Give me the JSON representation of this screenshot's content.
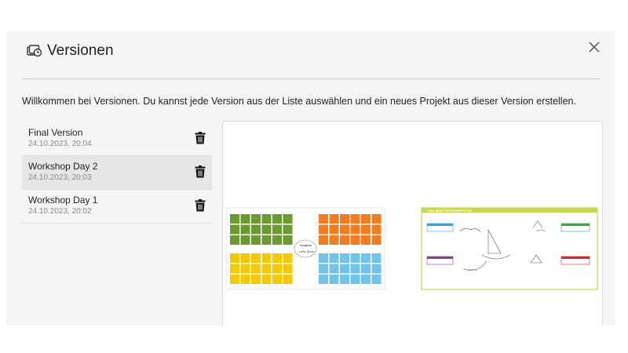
{
  "dialog": {
    "title": "Versionen",
    "title_icon": "versions-icon",
    "close_icon": "close-icon",
    "welcome_text": "Willkommen bei Versionen. Du kannst jede Version aus der Liste auswählen und ein neues Projekt aus dieser Version erstellen."
  },
  "versions": [
    {
      "name": "Final Version",
      "date": "24.10.2023, 20:04",
      "selected": false
    },
    {
      "name": "Workshop Day 2",
      "date": "24.10.2023, 20:03",
      "selected": true
    },
    {
      "name": "Workshop Day 1",
      "date": "24.10.2023, 20:02",
      "selected": false
    }
  ],
  "preview": {
    "board_left": {
      "center_labels": [
        "Keep",
        "Add",
        "Less",
        "More"
      ],
      "colors": {
        "green": "#6b9a33",
        "orange": "#f47b20",
        "yellow": "#f5c800",
        "blue": "#6fc3ec"
      }
    },
    "board_right": {
      "title": "SAIL BOAT RETROSPECTIVE",
      "border_color": "#c8d84a",
      "tag_colors": [
        "#29a8e0",
        "#2fa84f",
        "#8e3b96",
        "#d9232e"
      ]
    }
  },
  "colors": {
    "accent_bg": "#f5f5f5",
    "selected_bg": "#e6e6e6"
  }
}
